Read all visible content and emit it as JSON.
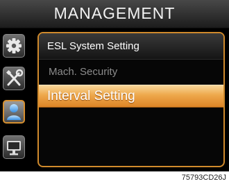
{
  "header": {
    "title": "MANAGEMENT"
  },
  "sidebar": {
    "items": [
      {
        "icon": "gear-icon",
        "active": false
      },
      {
        "icon": "tools-icon",
        "active": false
      },
      {
        "icon": "user-icon",
        "active": true
      },
      {
        "icon": "monitor-icon",
        "active": false
      }
    ]
  },
  "panel": {
    "title": "ESL System Setting",
    "items": [
      {
        "label": "Mach. Security",
        "selected": false
      },
      {
        "label": "Interval Setting",
        "selected": true
      }
    ]
  },
  "caption": "75793CD26J",
  "colors": {
    "accent": "#d08a2c",
    "selected_top": "#f7d69a",
    "selected_bottom": "#dc8427",
    "background": "#000000"
  }
}
